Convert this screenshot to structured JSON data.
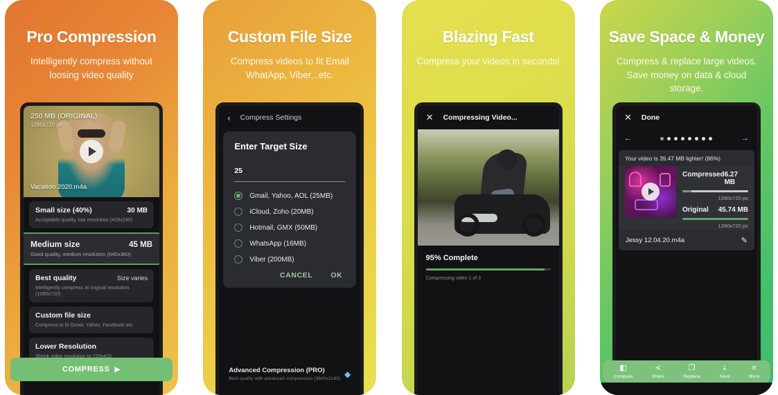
{
  "panels": [
    {
      "id": "pro-compression",
      "headline": "Pro Compression",
      "subhead": "Intelligently compress without loosing video quality",
      "video": {
        "size_label": "250 MB (ORIGINAL)",
        "resolution": "1280x720 px",
        "filename": "Vacation 2020.m4a",
        "play_icon": "play-icon"
      },
      "options": [
        {
          "title": "Small size (40%)",
          "value": "30 MB",
          "sub": "Acceptable quality, low resolution (428x240)",
          "selected": false,
          "value_light": false
        },
        {
          "title": "Medium size",
          "value": "45 MB",
          "sub": "Good quality, medium resolution (640x360)",
          "selected": true,
          "value_light": false
        },
        {
          "title": "Best quality",
          "value": "Size varies",
          "sub": "Intelligently compress at original resolution (1080x720)",
          "selected": false,
          "value_light": true
        },
        {
          "title": "Custom file size",
          "value": "",
          "sub": "Compress to fit Gmail, Yahoo, Facebook etc.",
          "selected": false,
          "value_light": false
        },
        {
          "title": "Lower Resolution",
          "value": "",
          "sub": "Shrink video resolution to 720x420",
          "selected": false,
          "value_light": false
        }
      ],
      "cta": {
        "label": "COMPRESS",
        "arrow": "▶"
      }
    },
    {
      "id": "custom-file-size",
      "headline": "Custom File Size",
      "subhead": "Compress videos to fit Email WhatApp, Viber...etc.",
      "appbar": {
        "back_icon": "chevron-left-icon",
        "title": "Compress Settings"
      },
      "dialog": {
        "title": "Enter Target Size",
        "value": "25",
        "options": [
          {
            "label": "Gmail, Yahoo, AOL (25MB)",
            "checked": true
          },
          {
            "label": "iCloud, Zoho (20MB)",
            "checked": false
          },
          {
            "label": "Hotmail, GMX (50MB)",
            "checked": false
          },
          {
            "label": "WhatsApp (16MB)",
            "checked": false
          },
          {
            "label": "Viber (200MB)",
            "checked": false
          }
        ],
        "cancel": "CANCEL",
        "ok": "OK"
      },
      "pro_row": {
        "title": "Advanced Compression (PRO)",
        "sub": "Best quality with advanced compression (3840x2160)",
        "icon": "diamond-icon",
        "glyph": "◆"
      }
    },
    {
      "id": "blazing-fast",
      "headline": "Blazing Fast",
      "subhead": "Compress your videos in seconds!",
      "appbar": {
        "close_icon": "close-icon",
        "title": "Compressing Video..."
      },
      "progress": {
        "title": "95% Complete",
        "percent": 95,
        "sub": "Compressing video 1 of 3"
      }
    },
    {
      "id": "save-space-money",
      "headline": "Save Space & Money",
      "subhead": "Compress & replace large videos. Save money on data & cloud storage.",
      "appbar": {
        "close_icon": "close-icon",
        "title": "Done"
      },
      "pager": {
        "prev_icon": "arrow-left-icon",
        "next_icon": "arrow-right-icon",
        "dots": 8,
        "active": 1
      },
      "result": {
        "banner": "Your video is 39.47 MB lighter! (86%)",
        "rows": [
          {
            "label": "Compressed",
            "size": "6.27 MB",
            "resolution": "1280x720 px",
            "fill": 14
          },
          {
            "label": "Original",
            "size": "45.74 MB",
            "resolution": "1280x720 px",
            "fill": 100
          }
        ],
        "filename": "Jessy 12.04.20.m4a",
        "edit_icon": "pencil-icon",
        "play_icon": "play-icon"
      },
      "toolbar": [
        {
          "label": "Compare",
          "icon": "compare-icon",
          "glyph": "◧"
        },
        {
          "label": "Share",
          "icon": "share-icon",
          "glyph": "≺"
        },
        {
          "label": "Replace",
          "icon": "replace-icon",
          "glyph": "❐"
        },
        {
          "label": "Save",
          "icon": "save-download-icon",
          "glyph": "⤓"
        },
        {
          "label": "More",
          "icon": "more-menu-icon",
          "glyph": "≡"
        }
      ]
    }
  ],
  "colors": {
    "accent_green": "#6cb26f",
    "cta_green": "#73bf74",
    "dark_bg": "#121214",
    "card_bg": "#26272b"
  }
}
